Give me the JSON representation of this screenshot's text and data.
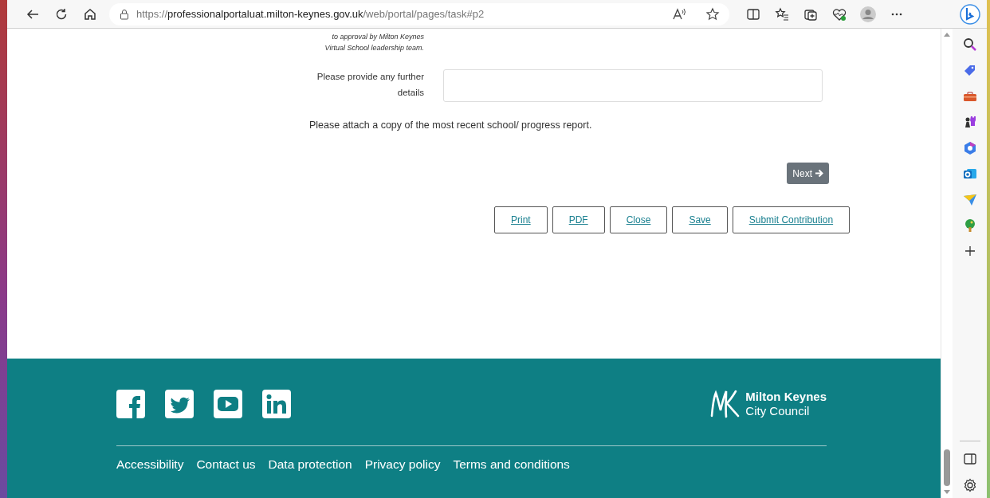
{
  "browser": {
    "address": {
      "scheme": "https://",
      "host": "professionalportaluat.milton-keynes.gov.uk",
      "path": "/web/portal/pages/task#p2"
    }
  },
  "form": {
    "note_lines": [
      "to approval by Milton Keynes",
      "Virtual School leadership team."
    ],
    "fields": [
      {
        "label": "Please provide any further details"
      }
    ],
    "attach_text": "Please attach a copy of the most recent school/ progress report.",
    "next_button": "Next",
    "actions": [
      "Print",
      "PDF",
      "Close",
      "Save",
      "Submit Contribution"
    ]
  },
  "footer": {
    "logo": {
      "line_1": "Milton Keynes",
      "line_2": "City Council"
    },
    "links": [
      "Accessibility",
      "Contact us",
      "Data protection",
      "Privacy policy",
      "Terms and conditions"
    ]
  }
}
